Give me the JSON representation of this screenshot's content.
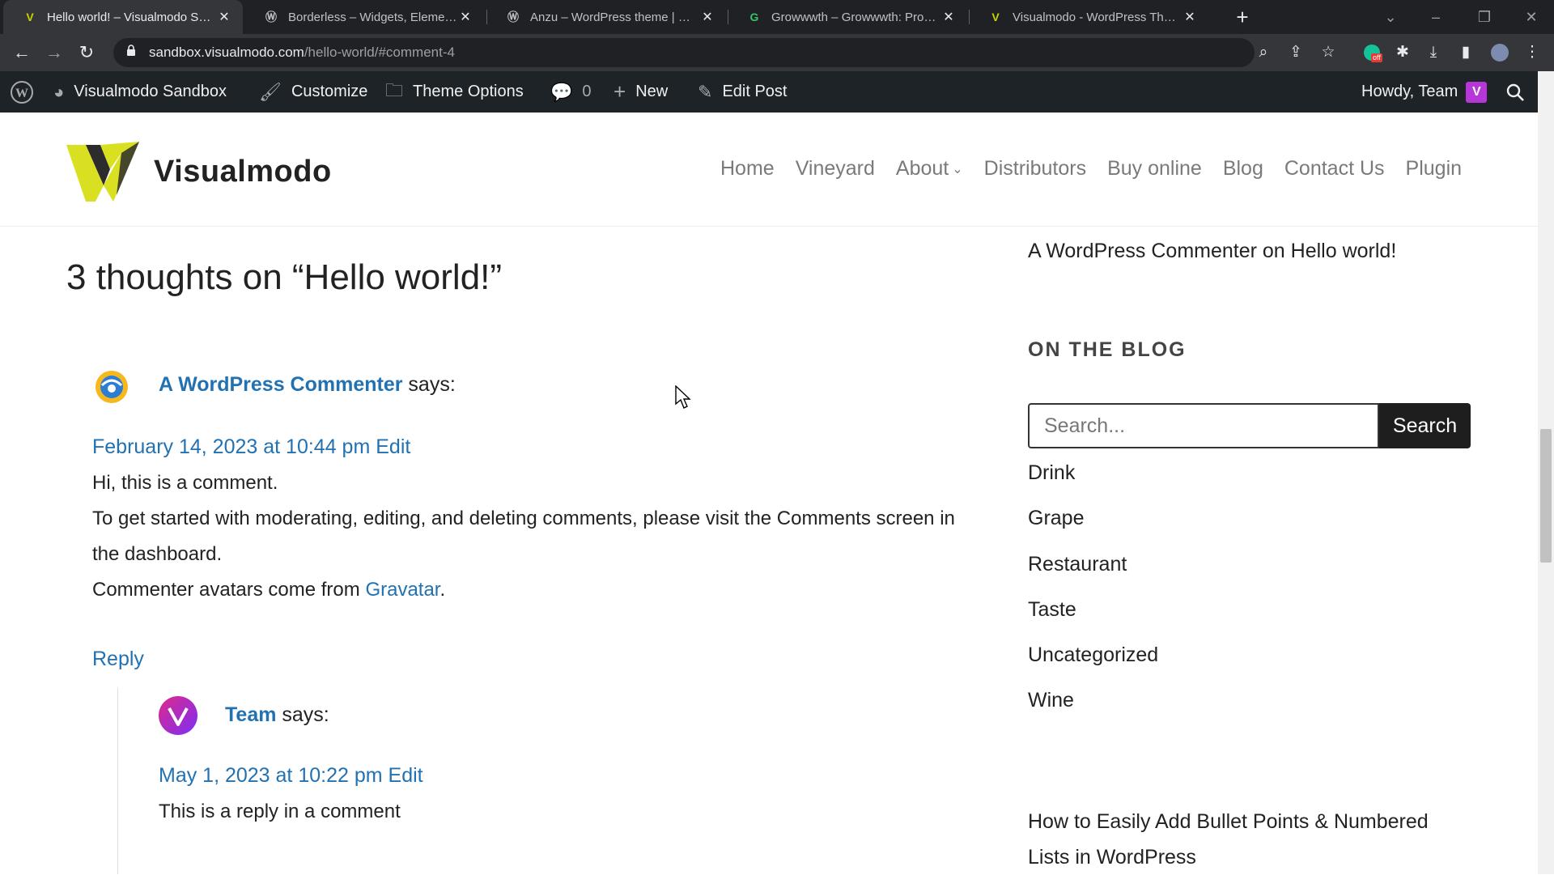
{
  "browser": {
    "tabs": [
      {
        "title": "Hello world! – Visualmodo Sandbox",
        "active": true,
        "favicon": "visualmodo-v-icon"
      },
      {
        "title": "Borderless – Widgets, Elements, Templates",
        "active": false,
        "favicon": "wordpress-icon"
      },
      {
        "title": "Anzu – WordPress theme | WordPress",
        "active": false,
        "favicon": "wordpress-icon"
      },
      {
        "title": "Growwwth – Growwwth: Programmatic",
        "active": false,
        "favicon": "growwwth-icon"
      },
      {
        "title": "Visualmodo - WordPress Themes",
        "active": false,
        "favicon": "visualmodo-v-icon"
      }
    ],
    "url_host": "sandbox.visualmodo.com",
    "url_path": "/hello-world/#comment-4",
    "extension_badge": "off"
  },
  "adminbar": {
    "site_name": "Visualmodo Sandbox",
    "customize": "Customize",
    "theme_options": "Theme Options",
    "comments_count": "0",
    "new": "New",
    "edit_post": "Edit Post",
    "howdy": "Howdy, Team"
  },
  "site": {
    "logo_text": "Visualmodo",
    "nav": [
      "Home",
      "Vineyard",
      "About",
      "Distributors",
      "Buy online",
      "Blog",
      "Contact Us",
      "Plugin"
    ]
  },
  "comments": {
    "title": "3 thoughts on “Hello world!”",
    "items": [
      {
        "author": "A WordPress Commenter",
        "says": "says:",
        "date": "February 14, 2023 at 10:44 pm",
        "edit": "Edit",
        "line1": "Hi, this is a comment.",
        "line2": "To get started with moderating, editing, and deleting comments, please visit the Comments screen in the dashboard.",
        "line3_prefix": "Commenter avatars come from ",
        "line3_link": "Gravatar",
        "line3_suffix": ".",
        "reply": "Reply"
      },
      {
        "author": "Team",
        "says": "says:",
        "date": "May 1, 2023 at 10:22 pm",
        "edit": "Edit",
        "text": "This is a reply in a comment"
      }
    ]
  },
  "sidebar": {
    "recent_comment": "A WordPress Commenter on Hello world!",
    "widget_title": "ON THE BLOG",
    "search_placeholder": "Search...",
    "search_button": "Search",
    "categories": [
      "Drink",
      "Grape",
      "Restaurant",
      "Taste",
      "Uncategorized",
      "Wine"
    ],
    "recent_post": "How to Easily Add Bullet Points & Numbered Lists in WordPress"
  }
}
